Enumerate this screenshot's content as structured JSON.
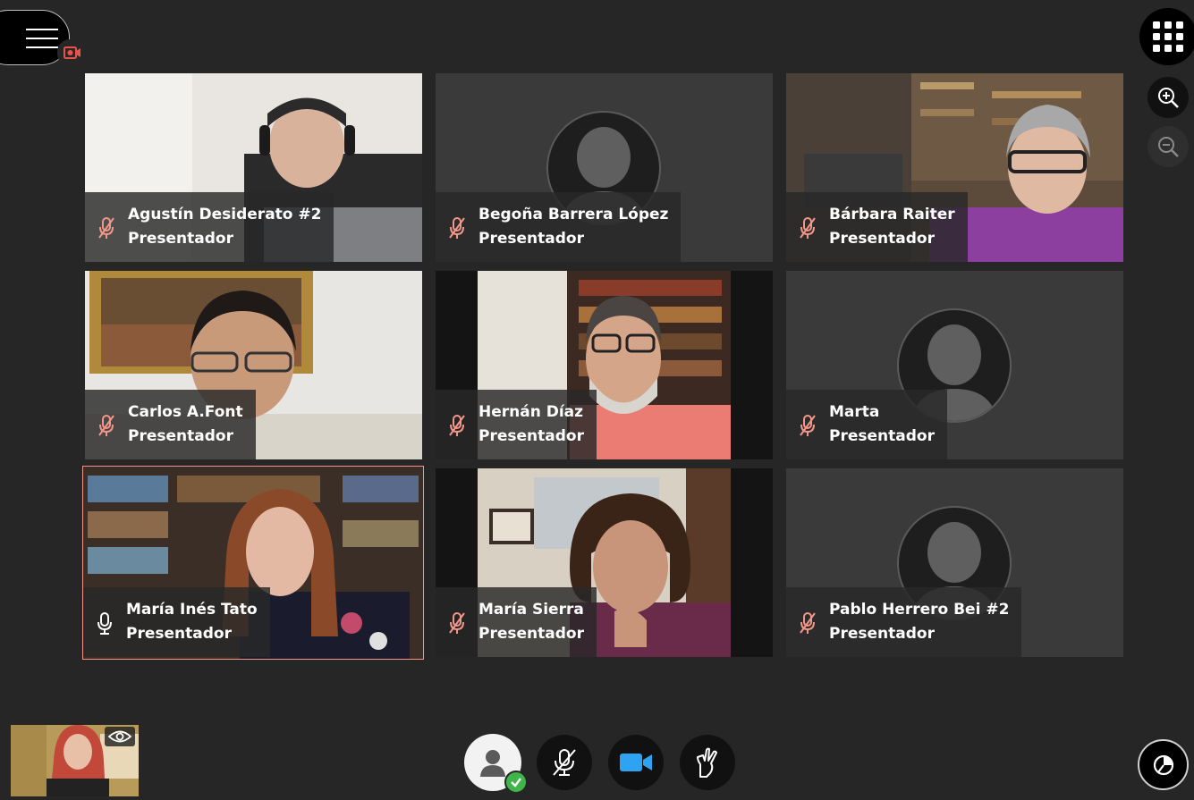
{
  "colors": {
    "background": "#262626",
    "tile": "#3a3a3a",
    "active_border": "#f2968a",
    "mic_muted": "#f2968a",
    "camera_on": "#2ea3f2",
    "status_ok": "#3fb54a"
  },
  "header": {
    "menu_icon": "hamburger-icon",
    "recording_icon": "recording-icon"
  },
  "participants": [
    {
      "name": "Agustín Desiderato #2",
      "role": "Presentador",
      "mic": "muted",
      "video": true
    },
    {
      "name": "Begoña Barrera López",
      "role": "Presentador",
      "mic": "muted",
      "video": false
    },
    {
      "name": "Bárbara Raiter",
      "role": "Presentador",
      "mic": "muted",
      "video": true
    },
    {
      "name": "Carlos A.Font",
      "role": "Presentador",
      "mic": "muted",
      "video": true
    },
    {
      "name": "Hernán Díaz",
      "role": "Presentador",
      "mic": "muted",
      "video": true
    },
    {
      "name": "Marta",
      "role": "Presentador",
      "mic": "muted",
      "video": false
    },
    {
      "name": "María Inés Tato",
      "role": "Presentador",
      "mic": "speaking",
      "video": true,
      "active": true
    },
    {
      "name": "María Sierra",
      "role": "Presentador",
      "mic": "muted",
      "video": true
    },
    {
      "name": "Pablo Herrero Bei #2",
      "role": "Presentador",
      "mic": "muted",
      "video": false
    }
  ],
  "right_controls": [
    {
      "icon": "grid-view-icon"
    },
    {
      "icon": "zoom-in-icon"
    },
    {
      "icon": "zoom-out-icon"
    }
  ],
  "bottom_controls": [
    {
      "icon": "user-status-icon",
      "status": "ok"
    },
    {
      "icon": "microphone-muted-icon"
    },
    {
      "icon": "camera-icon"
    },
    {
      "icon": "raise-hand-icon"
    }
  ],
  "self_view": {
    "icon": "eye-icon"
  },
  "network_icon": "network-status-icon"
}
